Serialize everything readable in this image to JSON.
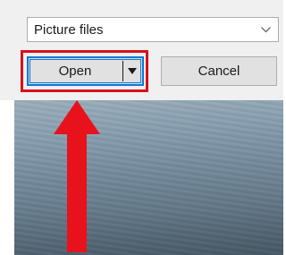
{
  "dialog": {
    "file_type_filter": {
      "selected_value": "Picture files",
      "icon": "chevron-down-icon"
    },
    "buttons": {
      "open_label": "Open",
      "open_dropdown_icon": "triangle-down-icon",
      "cancel_label": "Cancel"
    }
  },
  "annotation": {
    "highlight_color": "#d9101c",
    "arrow_color": "#e8121c",
    "arrow_direction": "up"
  },
  "colors": {
    "dialog_background": "#f0f0f0",
    "button_background": "#e1e1e1",
    "focus_border": "#0a78d7"
  }
}
